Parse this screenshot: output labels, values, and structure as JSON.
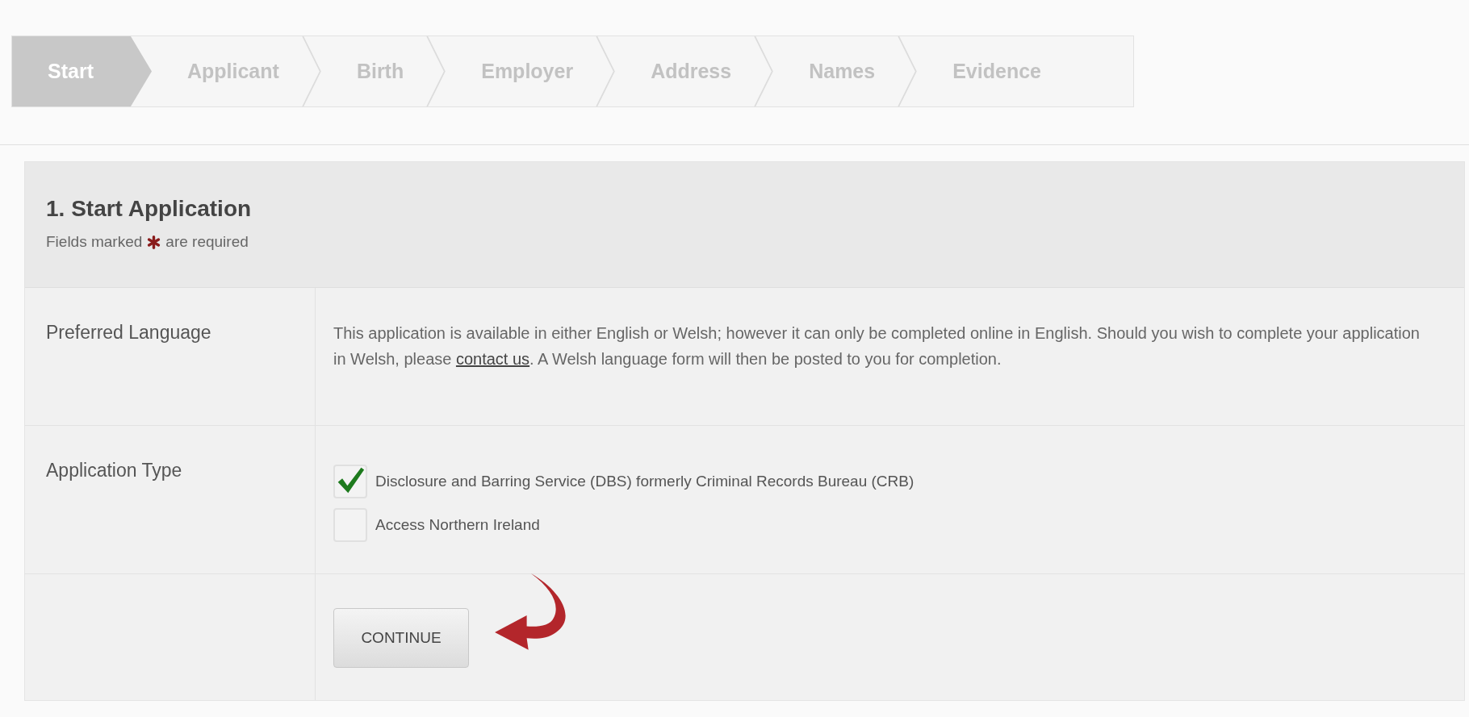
{
  "steps": [
    {
      "label": "Start",
      "selected": true
    },
    {
      "label": "Applicant",
      "selected": false
    },
    {
      "label": "Birth",
      "selected": false
    },
    {
      "label": "Employer",
      "selected": false
    },
    {
      "label": "Address",
      "selected": false
    },
    {
      "label": "Names",
      "selected": false
    },
    {
      "label": "Evidence",
      "selected": false
    }
  ],
  "panel": {
    "title": "1. Start Application",
    "required_note": {
      "before": "Fields marked",
      "after": "are required"
    }
  },
  "rows": [
    {
      "kind": "text",
      "label": "Preferred Language",
      "text_before": "This application is available in either English or Welsh; however it can only be completed online in English. Should you wish to complete your application in Welsh, please ",
      "link": "contact us",
      "text_after": ". A Welsh language form will then be posted to you for completion."
    },
    {
      "kind": "checkboxes",
      "label": "Application Type",
      "options": [
        {
          "label": "Disclosure and Barring Service (DBS) formerly Criminal Records Bureau (CRB)",
          "checked": true
        },
        {
          "label": "Access Northern Ireland",
          "checked": false
        }
      ]
    },
    {
      "kind": "button",
      "button": "CONTINUE"
    }
  ]
}
